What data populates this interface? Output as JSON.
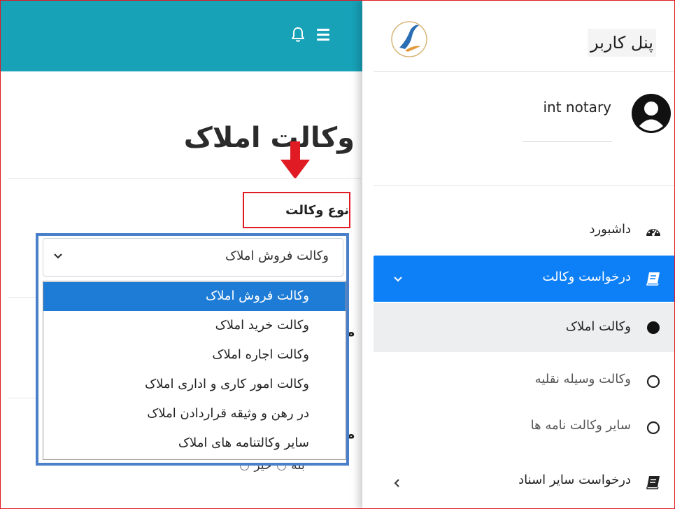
{
  "sidebar": {
    "brand": "پنل کاربر",
    "user_name": "int notary",
    "items": [
      {
        "label": "داشبورد"
      },
      {
        "label": "درخواست وکالت"
      },
      {
        "label": "وکالت املاک"
      },
      {
        "label": "وکالت وسیله نقلیه"
      },
      {
        "label": "سایر وکالت نامه ها"
      },
      {
        "label": "درخواست سایر اسناد"
      }
    ]
  },
  "main": {
    "title": "وکالت املاک",
    "field_label": "نوع وکالت",
    "select_value": "وکالت فروش املاک",
    "options": [
      "وکالت فروش املاک",
      "وکالت خرید املاک",
      "وکالت اجاره املاک",
      "وکالت امور کاری و اداری املاک",
      "در رهن و وثیقه قراردادن املاک",
      "سایر وکالتنامه های املاک"
    ],
    "radio_yes": "بله",
    "radio_no": "خیر",
    "partial_label": "م"
  },
  "colors": {
    "topbar": "#17a2b8",
    "active": "#0d7ff7",
    "selected_option": "#1e7cd6",
    "highlight_border": "#e01b24",
    "dropdown_frame": "#4a80c9"
  }
}
